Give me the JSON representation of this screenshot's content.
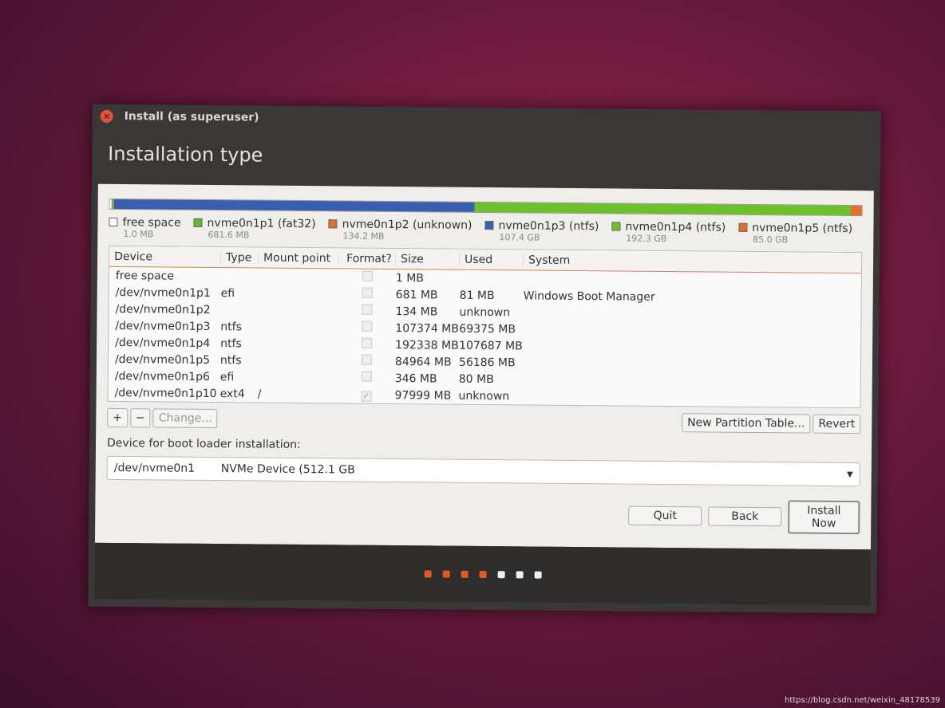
{
  "window": {
    "title": "Install (as superuser)",
    "heading": "Installation type"
  },
  "partition_bar": [
    {
      "name": "free space",
      "size": "1.0 MB",
      "color": "#ffffff",
      "fraction": 0.002
    },
    {
      "name": "nvme0n1p1 (fat32)",
      "size": "681.6 MB",
      "color": "#5fbb2f",
      "fraction": 0.002
    },
    {
      "name": "nvme0n1p2 (unknown)",
      "size": "134.2 MB",
      "color": "#e07030",
      "fraction": 0.001
    },
    {
      "name": "nvme0n1p3 (ntfs)",
      "size": "107.4 GB",
      "color": "#3a5fb0",
      "fraction": 0.48
    },
    {
      "name": "nvme0n1p4 (ntfs)",
      "size": "192.3 GB",
      "color": "#6cc02c",
      "fraction": 0.5
    },
    {
      "name": "nvme0n1p5 (ntfs)",
      "size": "85.0 GB",
      "color": "#e07030",
      "fraction": 0.015
    }
  ],
  "table": {
    "headers": [
      "Device",
      "Type",
      "Mount point",
      "Format?",
      "Size",
      "Used",
      "System"
    ],
    "rows": [
      {
        "device": "free space",
        "type": "",
        "mount": "",
        "format": false,
        "size": "1 MB",
        "used": "",
        "system": ""
      },
      {
        "device": "/dev/nvme0n1p1",
        "type": "efi",
        "mount": "",
        "format": false,
        "size": "681 MB",
        "used": "81 MB",
        "system": "Windows Boot Manager"
      },
      {
        "device": "/dev/nvme0n1p2",
        "type": "",
        "mount": "",
        "format": false,
        "size": "134 MB",
        "used": "unknown",
        "system": ""
      },
      {
        "device": "/dev/nvme0n1p3",
        "type": "ntfs",
        "mount": "",
        "format": false,
        "size": "107374 MB",
        "used": "69375 MB",
        "system": ""
      },
      {
        "device": "/dev/nvme0n1p4",
        "type": "ntfs",
        "mount": "",
        "format": false,
        "size": "192338 MB",
        "used": "107687 MB",
        "system": ""
      },
      {
        "device": "/dev/nvme0n1p5",
        "type": "ntfs",
        "mount": "",
        "format": false,
        "size": "84964 MB",
        "used": "56186 MB",
        "system": ""
      },
      {
        "device": "/dev/nvme0n1p6",
        "type": "efi",
        "mount": "",
        "format": false,
        "size": "346 MB",
        "used": "80 MB",
        "system": ""
      },
      {
        "device": "/dev/nvme0n1p10",
        "type": "ext4",
        "mount": "/",
        "format": true,
        "size": "97999 MB",
        "used": "unknown",
        "system": ""
      }
    ]
  },
  "buttons": {
    "add": "+",
    "remove": "−",
    "change": "Change...",
    "new_table": "New Partition Table...",
    "revert": "Revert",
    "quit": "Quit",
    "back": "Back",
    "install": "Install Now"
  },
  "bootloader": {
    "label": "Device for boot loader installation:",
    "device": "/dev/nvme0n1",
    "description": "NVMe Device (512.1 GB"
  },
  "progress": {
    "total_steps": 7,
    "completed": 4,
    "active_color": "#e05a28"
  },
  "watermark": "https://blog.csdn.net/weixin_48178539"
}
